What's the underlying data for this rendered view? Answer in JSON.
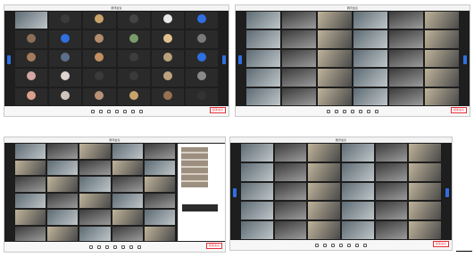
{
  "panels": [
    {
      "title": "腾讯会议",
      "end_label": "结束会议",
      "tiles": [
        {
          "name": "",
          "video": true
        },
        {
          "name": "",
          "color": "#3a3a3a"
        },
        {
          "name": "",
          "color": "#c9a36b"
        },
        {
          "name": "",
          "color": "#444"
        },
        {
          "name": "",
          "color": "#e8e8e8"
        },
        {
          "name": "",
          "color": "#2f6fe0"
        },
        {
          "name": "",
          "color": "#8a6f5a"
        },
        {
          "name": "",
          "color": "#2f6fe0"
        },
        {
          "name": "",
          "color": "#b28c6e"
        },
        {
          "name": "",
          "color": "#7a9c6b"
        },
        {
          "name": "",
          "color": "#e1c08e"
        },
        {
          "name": "",
          "color": "#7a7a7a"
        },
        {
          "name": "",
          "color": "#a57b5d"
        },
        {
          "name": "",
          "color": "#5d6f8c"
        },
        {
          "name": "",
          "color": "#c28f5f"
        },
        {
          "name": "",
          "color": "#3d3d3d"
        },
        {
          "name": "",
          "color": "#b7a27d"
        },
        {
          "name": "",
          "color": "#2f6fe0"
        },
        {
          "name": "",
          "color": "#d4a7a3"
        },
        {
          "name": "",
          "color": "#e0d4d0"
        },
        {
          "name": "",
          "color": "#3a3a3a"
        },
        {
          "name": "",
          "color": "#3a3a3a"
        },
        {
          "name": "",
          "color": "#bfa380"
        },
        {
          "name": "",
          "color": "#8a8a8a"
        },
        {
          "name": "",
          "color": "#d9a08e"
        },
        {
          "name": "",
          "color": "#cfc5bc"
        },
        {
          "name": "",
          "color": "#b89178"
        },
        {
          "name": "",
          "color": "#c9a36b"
        },
        {
          "name": "",
          "color": "#9a6f52"
        },
        {
          "name": "",
          "color": "#333"
        }
      ]
    },
    {
      "title": "腾讯会议",
      "end_label": "结束会议",
      "tiles": [
        {
          "video": true
        },
        {
          "video": true
        },
        {
          "video": true
        },
        {
          "video": true
        },
        {
          "video": true
        },
        {
          "video": true
        },
        {
          "video": true
        },
        {
          "video": true
        },
        {
          "video": true
        },
        {
          "video": true
        },
        {
          "video": true
        },
        {
          "video": true
        },
        {
          "video": true
        },
        {
          "video": true
        },
        {
          "video": true
        },
        {
          "video": true
        },
        {
          "video": true
        },
        {
          "video": true
        },
        {
          "video": true
        },
        {
          "video": true
        },
        {
          "video": true
        },
        {
          "video": true
        },
        {
          "video": true
        },
        {
          "video": true
        },
        {
          "video": true
        },
        {
          "video": true
        },
        {
          "video": true
        },
        {
          "video": true
        },
        {
          "video": true
        },
        {
          "video": true
        }
      ]
    },
    {
      "title": "腾讯会议",
      "end_label": "结束会议",
      "tiles": [
        {
          "video": true
        },
        {
          "video": true
        },
        {
          "video": true
        },
        {
          "video": true
        },
        {
          "video": true
        },
        {
          "video": true
        },
        {
          "video": true
        },
        {
          "video": true
        },
        {
          "video": true
        },
        {
          "video": true
        },
        {
          "video": true
        },
        {
          "video": true
        },
        {
          "video": true
        },
        {
          "video": true
        },
        {
          "video": true
        },
        {
          "video": true
        },
        {
          "video": true
        },
        {
          "video": true
        },
        {
          "video": true
        },
        {
          "video": true
        },
        {
          "video": true
        },
        {
          "video": true
        },
        {
          "video": true
        },
        {
          "video": true
        },
        {
          "video": true
        },
        {
          "video": true
        },
        {
          "video": true
        },
        {
          "video": true
        },
        {
          "video": true
        },
        {
          "video": true
        }
      ]
    },
    {
      "title": "腾讯会议",
      "end_label": "结束会议",
      "tiles": [
        {
          "video": true
        },
        {
          "video": true
        },
        {
          "video": true
        },
        {
          "video": true
        },
        {
          "video": true
        },
        {
          "video": true
        },
        {
          "video": true
        },
        {
          "video": true
        },
        {
          "video": true
        },
        {
          "video": true
        },
        {
          "video": true
        },
        {
          "video": true
        },
        {
          "video": true
        },
        {
          "video": true
        },
        {
          "video": true
        },
        {
          "video": true
        },
        {
          "video": true
        },
        {
          "video": true
        },
        {
          "video": true
        },
        {
          "video": true
        },
        {
          "video": true
        },
        {
          "video": true
        },
        {
          "video": true
        },
        {
          "video": true
        },
        {
          "video": true
        },
        {
          "video": true
        },
        {
          "video": true
        },
        {
          "video": true
        },
        {
          "video": true
        },
        {
          "video": true
        }
      ]
    }
  ],
  "toolbar_icons": [
    "mic-icon",
    "camera-icon",
    "share-icon",
    "participants-icon",
    "chat-icon",
    "record-icon",
    "settings-icon"
  ]
}
